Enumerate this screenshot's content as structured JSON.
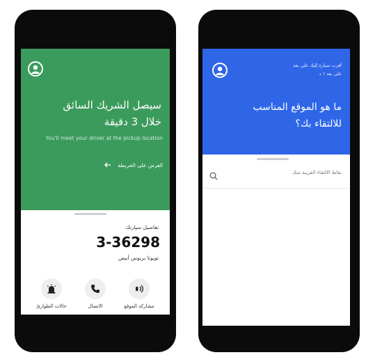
{
  "colors": {
    "green": "#3b9b5c",
    "blue": "#2f66e8",
    "phone": "#0b0b0b"
  },
  "left_screen": {
    "avatar_icon": "user-icon",
    "title_line1": "سيصل الشريك السائق",
    "title_line2": "خلال 3 دقيقة",
    "subtitle": "You'll meet your driver at the pickup location",
    "map_link": "العرض على الخريطة",
    "map_link_icon": "arrow-left-icon",
    "car_details_label": "تفاصيل سيارتك",
    "plate_number": "3-36298",
    "car_model": "تويوتا بريوس أبيض",
    "actions": [
      {
        "label": "حالات الطوارئ",
        "icon": "alarm-icon"
      },
      {
        "label": "الاتصال",
        "icon": "phone-icon"
      },
      {
        "label": "مشاركة الموقع",
        "icon": "location-share-icon"
      }
    ]
  },
  "right_screen": {
    "avatar_icon": "user-icon",
    "nearest_car_label": "أقرب سيارة إليك على بعد",
    "nearest_car_time": "على بعد ١ د",
    "question_line1": "ما هو الموقع المناسب",
    "question_line2": "للالتقاء بك؟",
    "search_placeholder": "نقاط الالتقاء القريبة منك",
    "search_icon": "search-icon"
  }
}
